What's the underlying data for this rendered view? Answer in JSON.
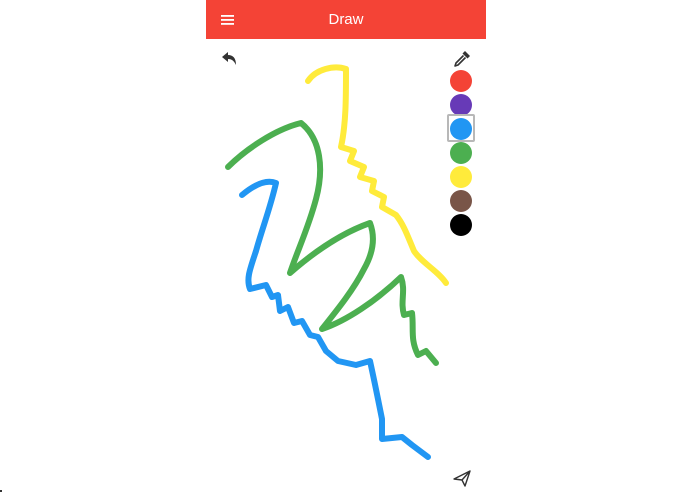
{
  "app_bar": {
    "title": "Draw",
    "background_color": "#f44336",
    "menu_icon": "hamburger-menu-icon"
  },
  "toolbar": {
    "undo_icon": "undo-arrow-icon",
    "eyedropper_icon": "eyedropper-icon",
    "send_icon": "paper-plane-icon"
  },
  "palette": {
    "selected_index": 2,
    "colors": [
      "#f44336",
      "#673ab7",
      "#2196f3",
      "#4caf50",
      "#ffeb3b",
      "#795548",
      "#000000"
    ]
  },
  "strokes": [
    {
      "color": "#ffeb3b",
      "name": "yellow-stroke"
    },
    {
      "color": "#4caf50",
      "name": "green-stroke"
    },
    {
      "color": "#2196f3",
      "name": "blue-stroke"
    }
  ]
}
